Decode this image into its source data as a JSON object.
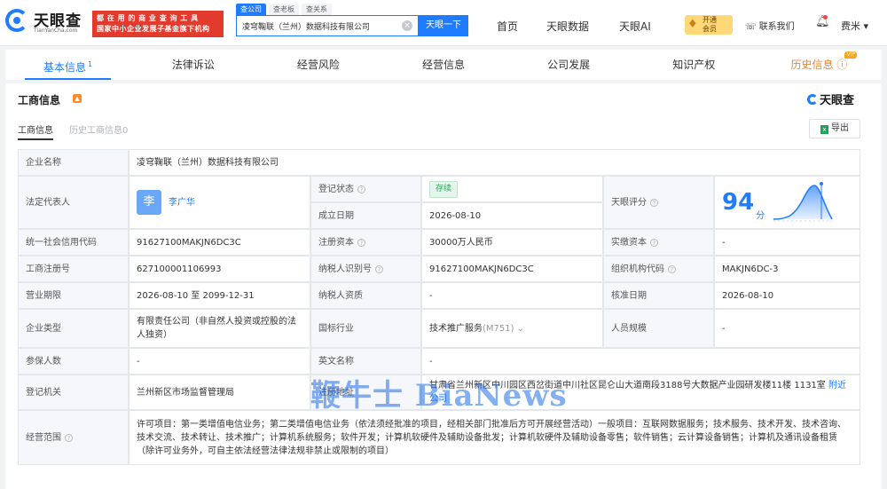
{
  "header": {
    "logo_text": "天眼查",
    "logo_sub": "TianYanCha.com",
    "promo_line1": "都 在 用 的 商 业 查 询 工 具",
    "promo_line2": "国家中小企业发展子基金旗下机构",
    "search_tabs": [
      "查公司",
      "查老板",
      "查关系"
    ],
    "search_value": "凌穹鞠联（兰州）数据科技有限公司",
    "search_button": "天眼一下",
    "nav": [
      "首页",
      "天眼数据",
      "天眼AI"
    ],
    "vip_line1": "开通",
    "vip_line2": "会员",
    "contact": "联系我们",
    "user": "费米"
  },
  "sections": {
    "tabs": [
      {
        "label": "基本信息",
        "count": "1"
      },
      {
        "label": "法律诉讼"
      },
      {
        "label": "经营风险"
      },
      {
        "label": "经营信息"
      },
      {
        "label": "公司发展"
      },
      {
        "label": "知识产权"
      },
      {
        "label": "历史信息",
        "badge": "VIP"
      }
    ]
  },
  "card": {
    "title": "工商信息",
    "brand": "天眼查",
    "sub_tabs": [
      "工商信息",
      "历史工商信息0"
    ],
    "export": "导出"
  },
  "info": {
    "company_name_label": "企业名称",
    "company_name": "凌穹鞠联（兰州）数据科技有限公司",
    "legal_rep_label": "法定代表人",
    "legal_rep_avatar": "李",
    "legal_rep": "李广华",
    "reg_status_label": "登记状态",
    "reg_status": "存续",
    "found_date_label": "成立日期",
    "found_date": "2026-08-10",
    "score_label": "天眼评分",
    "score": "94",
    "score_unit": "分",
    "credit_code_label": "统一社会信用代码",
    "credit_code": "91627100MAKJN6DC3C",
    "reg_capital_label": "注册资本",
    "reg_capital": "30000万人民币",
    "paid_capital_label": "实缴资本",
    "paid_capital": "-",
    "reg_no_label": "工商注册号",
    "reg_no": "627100001106993",
    "taxpayer_id_label": "纳税人识别号",
    "taxpayer_id": "91627100MAKJN6DC3C",
    "org_code_label": "组织机构代码",
    "org_code": "MAKJN6DC-3",
    "term_label": "营业期限",
    "term": "2026-08-10 至 2099-12-31",
    "taxpayer_qual_label": "纳税人资质",
    "taxpayer_qual": "-",
    "approve_date_label": "核准日期",
    "approve_date": "2026-08-10",
    "type_label": "企业类型",
    "type": "有限责任公司（非自然人投资或控股的法人独资）",
    "industry_label": "国标行业",
    "industry": "技术推广服务",
    "industry_code": "(M751)",
    "staff_label": "人员规模",
    "staff": "-",
    "insured_label": "参保人数",
    "insured": "-",
    "english_name_label": "英文名称",
    "english_name": "-",
    "authority_label": "登记机关",
    "authority": "兰州新区市场监督管理局",
    "address_label": "注册地址",
    "address": "甘肃省兰州新区中川园区西岔街道中川社区昆仑山大道南段3188号大数据产业园研发楼11楼 1131室",
    "nearby": "附近公司",
    "scope_label": "经营范围",
    "scope": "许可项目：第一类增值电信业务；第二类增值电信业务（依法须经批准的项目，经相关部门批准后方可开展经营活动）一般项目：互联网数据服务；技术服务、技术开发、技术咨询、技术交流、技术转让、技术推广；计算机系统服务；软件开发；计算机软硬件及辅助设备批发；计算机软硬件及辅助设备零售；软件销售；云计算设备销售；计算机及通讯设备租赁（除许可业务外，可自主依法经营法律法规非禁止或限制的项目）"
  },
  "watermark": "鞭牛士 BiaNews",
  "colors": {
    "accent": "#1f7bff",
    "promo": "#e23b2e",
    "status_green": "#2ca35f"
  }
}
